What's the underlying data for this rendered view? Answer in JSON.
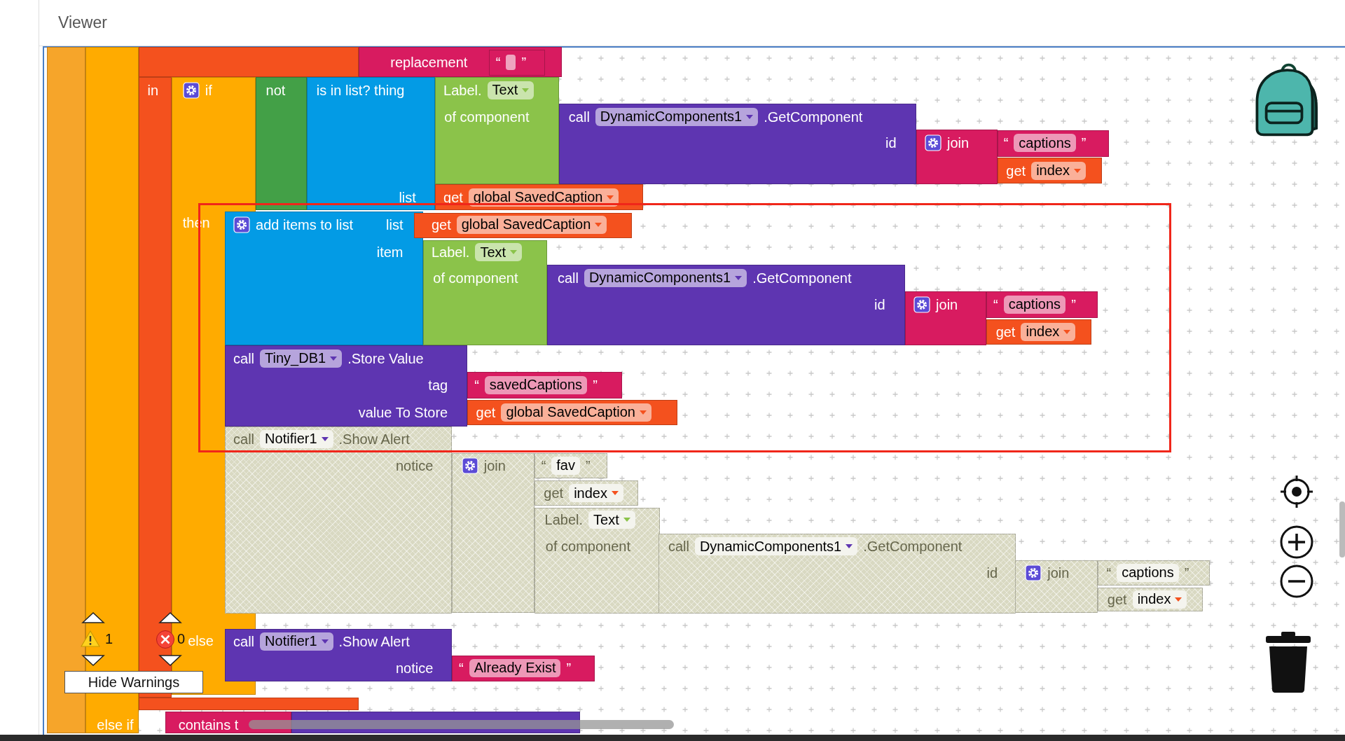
{
  "header": {
    "title": "Viewer"
  },
  "blocks": [
    {
      "kind": "event",
      "disabled": false
    },
    {
      "kind": "control",
      "disabled": false,
      "rows": [
        [
          {
            "kind": "label",
            "text": "else if"
          }
        ]
      ]
    },
    {
      "kind": "variables",
      "disabled": false,
      "rows": [
        [
          {
            "kind": "label",
            "text": "in"
          }
        ]
      ]
    },
    {
      "kind": "text",
      "disabled": false,
      "rows": [
        [
          {
            "kind": "label",
            "text": "replacement"
          }
        ]
      ]
    },
    {
      "kind": "text",
      "disabled": false,
      "rows": [
        [
          {
            "kind": "quote",
            "text": "“"
          },
          {
            "kind": "field"
          },
          {
            "kind": "quote",
            "text": "”"
          }
        ]
      ]
    },
    {
      "kind": "control",
      "disabled": false,
      "rows": [
        [
          {
            "kind": "gear"
          },
          {
            "kind": "label",
            "text": "if"
          }
        ],
        [
          {
            "kind": "label",
            "text": "then"
          }
        ],
        [
          {
            "kind": "label",
            "text": "else"
          }
        ]
      ]
    },
    {
      "kind": "logic",
      "disabled": false,
      "rows": [
        [
          {
            "kind": "label",
            "text": "not"
          }
        ]
      ]
    },
    {
      "kind": "lists",
      "disabled": false,
      "rows": [
        [
          {
            "kind": "label",
            "text": "is in list? thing"
          }
        ],
        [
          {
            "kind": "label",
            "text": "list"
          }
        ]
      ]
    },
    {
      "kind": "component",
      "disabled": false,
      "rows": [
        [
          {
            "kind": "label",
            "text": "Label."
          },
          {
            "kind": "dropdown",
            "text": "Text"
          }
        ],
        [
          {
            "kind": "label",
            "text": "of component"
          }
        ]
      ]
    },
    {
      "kind": "method",
      "disabled": false,
      "rows": [
        [
          {
            "kind": "label",
            "text": "call"
          },
          {
            "kind": "dropdown",
            "text": "DynamicComponents1"
          },
          {
            "kind": "label",
            "text": ".GetComponent"
          }
        ],
        [
          {
            "kind": "label",
            "text": "id"
          }
        ]
      ]
    },
    {
      "kind": "text",
      "disabled": false,
      "rows": [
        [
          {
            "kind": "gear"
          },
          {
            "kind": "label",
            "text": "join"
          }
        ]
      ]
    },
    {
      "kind": "text",
      "disabled": false,
      "rows": [
        [
          {
            "kind": "quote",
            "text": "“"
          },
          {
            "kind": "field",
            "text": "captions"
          },
          {
            "kind": "quote",
            "text": "”"
          }
        ]
      ]
    },
    {
      "kind": "variables",
      "disabled": false,
      "rows": [
        [
          {
            "kind": "label",
            "text": "get"
          },
          {
            "kind": "dropdown",
            "text": "index"
          }
        ]
      ]
    },
    {
      "kind": "variables",
      "disabled": false,
      "rows": [
        [
          {
            "kind": "label",
            "text": "get"
          },
          {
            "kind": "dropdown",
            "text": "global SavedCaption"
          }
        ]
      ]
    },
    {
      "kind": "lists",
      "disabled": false,
      "rows": [
        [
          {
            "kind": "gear"
          },
          {
            "kind": "label",
            "text": "add items to list"
          }
        ],
        [
          {
            "kind": "label",
            "text": "list"
          }
        ],
        [
          {
            "kind": "label",
            "text": "item"
          }
        ]
      ]
    },
    {
      "kind": "variables",
      "disabled": false,
      "rows": [
        [
          {
            "kind": "label",
            "text": "get"
          },
          {
            "kind": "dropdown",
            "text": "global SavedCaption"
          }
        ]
      ]
    },
    {
      "kind": "component",
      "disabled": false,
      "rows": [
        [
          {
            "kind": "label",
            "text": "Label."
          },
          {
            "kind": "dropdown",
            "text": "Text"
          }
        ],
        [
          {
            "kind": "label",
            "text": "of component"
          }
        ]
      ]
    },
    {
      "kind": "method",
      "disabled": false,
      "rows": [
        [
          {
            "kind": "label",
            "text": "call"
          },
          {
            "kind": "dropdown",
            "text": "DynamicComponents1"
          },
          {
            "kind": "label",
            "text": ".GetComponent"
          }
        ],
        [
          {
            "kind": "label",
            "text": "id"
          }
        ]
      ]
    },
    {
      "kind": "text",
      "disabled": false,
      "rows": [
        [
          {
            "kind": "gear"
          },
          {
            "kind": "label",
            "text": "join"
          }
        ]
      ]
    },
    {
      "kind": "text",
      "disabled": false,
      "rows": [
        [
          {
            "kind": "quote",
            "text": "“"
          },
          {
            "kind": "field",
            "text": "captions"
          },
          {
            "kind": "quote",
            "text": "”"
          }
        ]
      ]
    },
    {
      "kind": "variables",
      "disabled": false,
      "rows": [
        [
          {
            "kind": "label",
            "text": "get"
          },
          {
            "kind": "dropdown",
            "text": "index"
          }
        ]
      ]
    },
    {
      "kind": "method",
      "disabled": false,
      "rows": [
        [
          {
            "kind": "label",
            "text": "call"
          },
          {
            "kind": "dropdown",
            "text": "Tiny_DB1"
          },
          {
            "kind": "label",
            "text": ".Store Value"
          }
        ],
        [
          {
            "kind": "label",
            "text": "tag"
          }
        ],
        [
          {
            "kind": "label",
            "text": "value To Store"
          }
        ]
      ]
    },
    {
      "kind": "text",
      "disabled": false,
      "rows": [
        [
          {
            "kind": "quote",
            "text": "“"
          },
          {
            "kind": "field",
            "text": "savedCaptions"
          },
          {
            "kind": "quote",
            "text": "”"
          }
        ]
      ]
    },
    {
      "kind": "variables",
      "disabled": false,
      "rows": [
        [
          {
            "kind": "label",
            "text": "get"
          },
          {
            "kind": "dropdown",
            "text": "global SavedCaption"
          }
        ]
      ]
    },
    {
      "kind": "method",
      "disabled": true,
      "rows": [
        [
          {
            "kind": "label",
            "text": "call"
          },
          {
            "kind": "dropdown",
            "text": "Notifier1"
          },
          {
            "kind": "label",
            "text": ".Show Alert"
          }
        ],
        [
          {
            "kind": "label",
            "text": "notice"
          }
        ]
      ]
    },
    {
      "kind": "text",
      "disabled": true,
      "rows": [
        [
          {
            "kind": "gear"
          },
          {
            "kind": "label",
            "text": "join"
          }
        ]
      ]
    },
    {
      "kind": "text",
      "disabled": true,
      "rows": [
        [
          {
            "kind": "quote",
            "text": "“"
          },
          {
            "kind": "field",
            "text": "fav"
          },
          {
            "kind": "quote",
            "text": "”"
          }
        ]
      ]
    },
    {
      "kind": "variables",
      "disabled": true,
      "rows": [
        [
          {
            "kind": "label",
            "text": "get"
          },
          {
            "kind": "dropdown",
            "text": "index"
          }
        ]
      ]
    },
    {
      "kind": "component",
      "disabled": true,
      "rows": [
        [
          {
            "kind": "label",
            "text": "Label."
          },
          {
            "kind": "dropdown",
            "text": "Text"
          }
        ],
        [
          {
            "kind": "label",
            "text": "of component"
          }
        ]
      ]
    },
    {
      "kind": "method",
      "disabled": true,
      "rows": [
        [
          {
            "kind": "label",
            "text": "call"
          },
          {
            "kind": "dropdown",
            "text": "DynamicComponents1"
          },
          {
            "kind": "label",
            "text": ".GetComponent"
          }
        ],
        [
          {
            "kind": "label",
            "text": "id"
          }
        ]
      ]
    },
    {
      "kind": "text",
      "disabled": true,
      "rows": [
        [
          {
            "kind": "gear"
          },
          {
            "kind": "label",
            "text": "join"
          }
        ]
      ]
    },
    {
      "kind": "text",
      "disabled": true,
      "rows": [
        [
          {
            "kind": "quote",
            "text": "“"
          },
          {
            "kind": "field",
            "text": "captions"
          },
          {
            "kind": "quote",
            "text": "”"
          }
        ]
      ]
    },
    {
      "kind": "variables",
      "disabled": true,
      "rows": [
        [
          {
            "kind": "label",
            "text": "get"
          },
          {
            "kind": "dropdown",
            "text": "index"
          }
        ]
      ]
    },
    {
      "kind": "method",
      "disabled": false,
      "rows": [
        [
          {
            "kind": "label",
            "text": "call"
          },
          {
            "kind": "dropdown",
            "text": "Notifier1"
          },
          {
            "kind": "label",
            "text": ".Show Alert"
          }
        ],
        [
          {
            "kind": "label",
            "text": "notice"
          }
        ]
      ]
    },
    {
      "kind": "text",
      "disabled": false,
      "rows": [
        [
          {
            "kind": "quote",
            "text": "“"
          },
          {
            "kind": "field",
            "text": "Already Exist"
          },
          {
            "kind": "quote",
            "text": "”"
          }
        ]
      ]
    },
    {
      "kind": "text",
      "disabled": false,
      "rows": [
        [
          {
            "kind": "label",
            "text": "contains t"
          }
        ]
      ]
    },
    {
      "kind": "method",
      "disabled": false
    }
  ],
  "warnings": {
    "count": "1"
  },
  "errors": {
    "count": "0"
  },
  "toggle_button": "Hide Warnings"
}
